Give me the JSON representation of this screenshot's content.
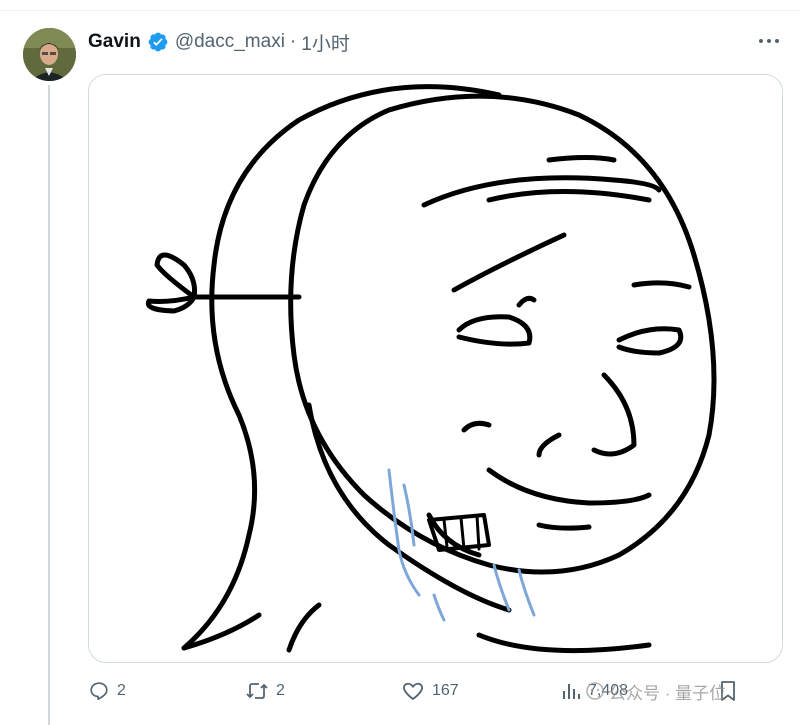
{
  "tweet": {
    "author_name": "Gavin",
    "author_handle": "@dacc_maxi",
    "separator": "·",
    "time": "1小时",
    "verified": true,
    "accent_color": "#1d9bf0"
  },
  "media": {
    "kind": "meme-drawing",
    "alt_icon": "wojak-mask-meme"
  },
  "actions": {
    "replies": "2",
    "retweets": "2",
    "likes": "167",
    "views": "7,408"
  },
  "watermark": {
    "text": "公众号 · 量子位"
  }
}
